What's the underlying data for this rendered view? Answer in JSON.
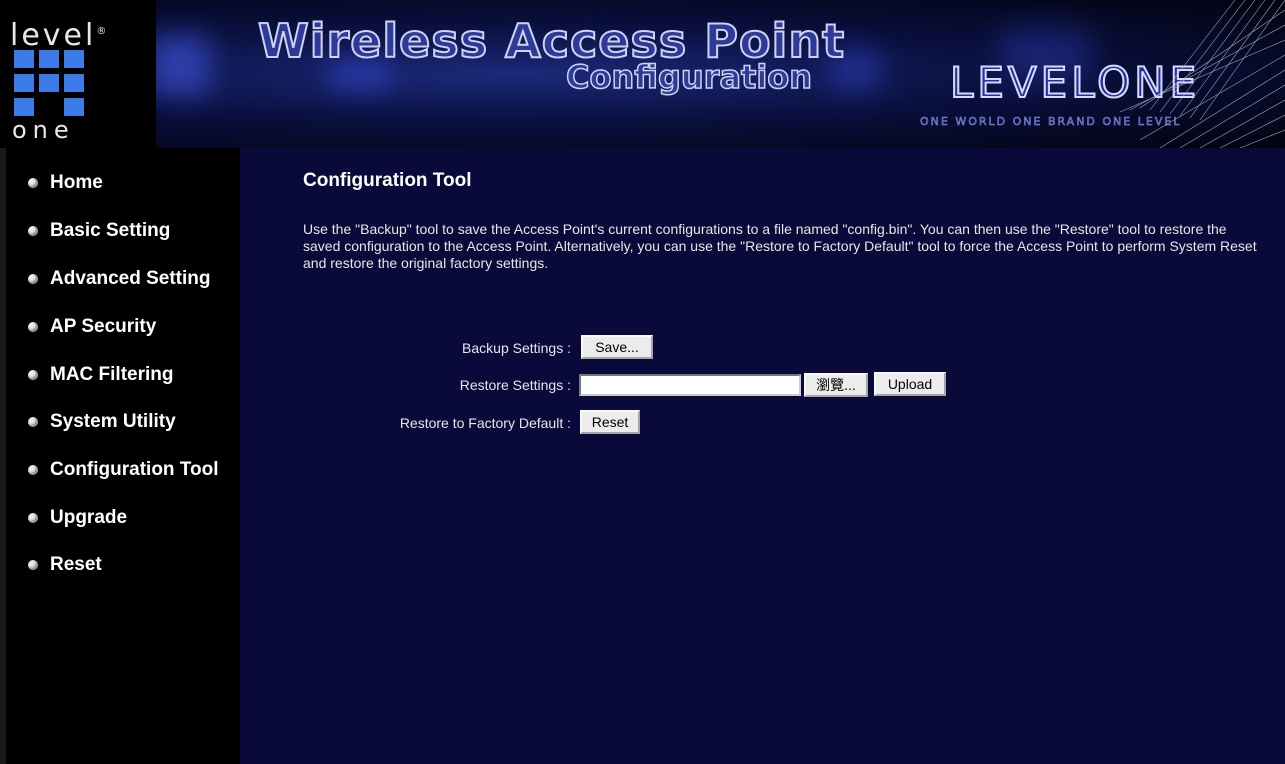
{
  "header": {
    "logo_top": "level",
    "logo_reg": "®",
    "logo_bottom": "one",
    "title": "Wireless Access Point",
    "subtitle": "Configuration",
    "brand": "LEVELONE",
    "slogan": "ONE WORLD ONE BRAND ONE LEVEL"
  },
  "sidebar": {
    "items": [
      {
        "label": "Home"
      },
      {
        "label": "Basic Setting"
      },
      {
        "label": "Advanced Setting"
      },
      {
        "label": "AP Security"
      },
      {
        "label": "MAC Filtering"
      },
      {
        "label": "System Utility"
      },
      {
        "label": "Configuration Tool"
      },
      {
        "label": "Upgrade"
      },
      {
        "label": "Reset"
      }
    ]
  },
  "main": {
    "title": "Configuration Tool",
    "description": "Use the \"Backup\" tool to save the Access Point's current configurations to a file named \"config.bin\". You can then use the \"Restore\" tool to restore the saved configuration to the Access Point. Alternatively, you can use the \"Restore to Factory Default\" tool to force the Access Point to perform System Reset and restore the original factory settings.",
    "backup": {
      "label": "Backup Settings :",
      "button": "Save..."
    },
    "restore": {
      "label": "Restore Settings :",
      "file_value": "",
      "browse_button": "瀏覽...",
      "upload_button": "Upload"
    },
    "factory": {
      "label": "Restore to Factory Default :",
      "button": "Reset"
    }
  }
}
